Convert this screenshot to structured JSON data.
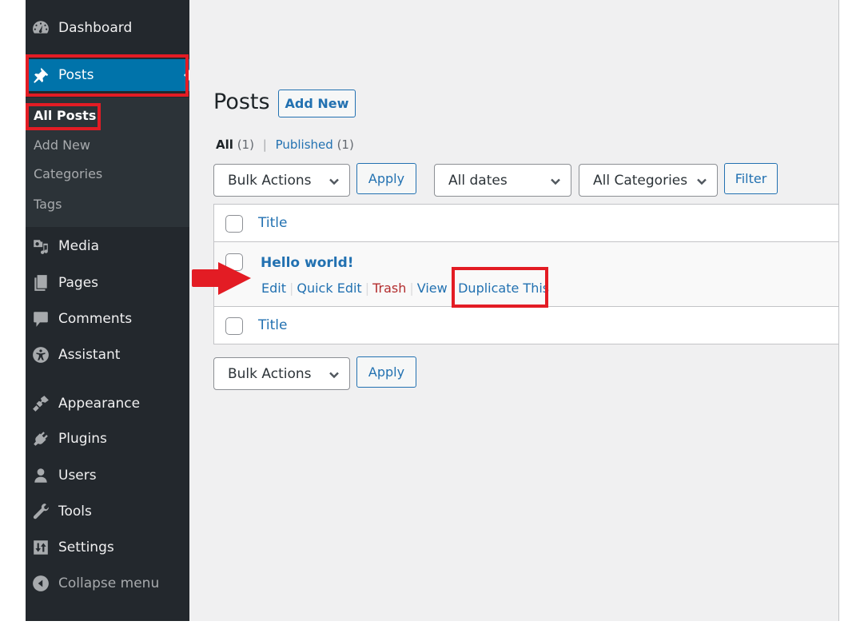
{
  "sidebar": {
    "items": [
      {
        "label": "Dashboard",
        "icon": "dashboard-icon"
      },
      {
        "label": "Posts",
        "icon": "pin-icon",
        "current": true
      },
      {
        "label": "Media",
        "icon": "media-icon"
      },
      {
        "label": "Pages",
        "icon": "pages-icon"
      },
      {
        "label": "Comments",
        "icon": "comments-icon"
      },
      {
        "label": "Assistant",
        "icon": "accessibility-icon"
      },
      {
        "label": "Appearance",
        "icon": "paintbrush-icon"
      },
      {
        "label": "Plugins",
        "icon": "plugin-icon"
      },
      {
        "label": "Users",
        "icon": "user-icon"
      },
      {
        "label": "Tools",
        "icon": "wrench-icon"
      },
      {
        "label": "Settings",
        "icon": "settings-icon"
      },
      {
        "label": "Collapse menu",
        "icon": "collapse-icon"
      }
    ],
    "submenu": [
      {
        "label": "All Posts",
        "active": true
      },
      {
        "label": "Add New"
      },
      {
        "label": "Categories"
      },
      {
        "label": "Tags"
      }
    ]
  },
  "main": {
    "page_title": "Posts",
    "add_new_label": "Add New",
    "views": {
      "all_label": "All",
      "all_count": "(1)",
      "separator": "|",
      "published_label": "Published",
      "published_count": "(1)"
    },
    "top_bulk_actions": "Bulk Actions",
    "top_apply_label": "Apply",
    "date_filter": "All dates",
    "category_filter": "All Categories",
    "filter_label": "Filter",
    "table": {
      "column_title": "Title",
      "rows": [
        {
          "title": "Hello world!",
          "actions": [
            "Edit",
            "Quick Edit",
            "Trash",
            "View",
            "Duplicate This"
          ]
        }
      ],
      "action_separator": "|"
    },
    "bottom_bulk_actions": "Bulk Actions",
    "bottom_apply_label": "Apply"
  },
  "annotations": {
    "highlight_color": "#e31c24",
    "arrow_color": "#e31c24"
  },
  "colors": {
    "sidebar_bg": "#23282d",
    "submenu_bg": "#2c3338",
    "accent": "#0073aa",
    "link": "#2271b1",
    "trash": "#b32d2e",
    "content_bg": "#f0f0f1"
  }
}
